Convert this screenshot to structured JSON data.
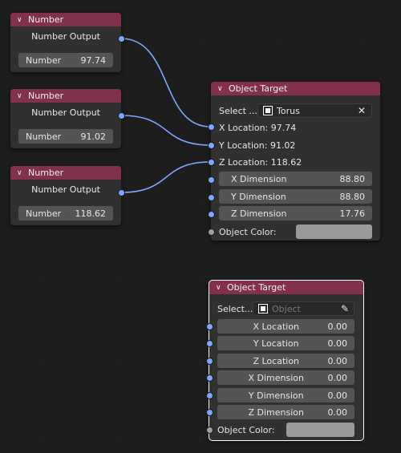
{
  "number_nodes": [
    {
      "title": "Number",
      "output": "Number Output",
      "field_label": "Number",
      "value": "97.74"
    },
    {
      "title": "Number",
      "output": "Number Output",
      "field_label": "Number",
      "value": "91.02"
    },
    {
      "title": "Number",
      "output": "Number Output",
      "field_label": "Number",
      "value": "118.62"
    }
  ],
  "target1": {
    "title": "Object Target",
    "select_label": "Select ...",
    "object_value": "Torus",
    "rows": [
      {
        "label": "X Location: 97.74"
      },
      {
        "label": "Y Location: 91.02"
      },
      {
        "label": "Z Location: 118.62"
      }
    ],
    "dims": [
      {
        "label": "X Dimension",
        "value": "88.80"
      },
      {
        "label": "Y Dimension",
        "value": "88.80"
      },
      {
        "label": "Z Dimension",
        "value": "17.76"
      }
    ],
    "color_label": "Object Color:",
    "color_value": "#9a9a9a"
  },
  "target2": {
    "title": "Object Target",
    "select_label": "Select...",
    "object_placeholder": "Object",
    "fields": [
      {
        "label": "X Location",
        "value": "0.00"
      },
      {
        "label": "Y Location",
        "value": "0.00"
      },
      {
        "label": "Z Location",
        "value": "0.00"
      },
      {
        "label": "X Dimension",
        "value": "0.00"
      },
      {
        "label": "Y Dimension",
        "value": "0.00"
      },
      {
        "label": "Z Dimension",
        "value": "0.00"
      }
    ],
    "color_label": "Object Color:"
  },
  "colors": {
    "header": "#83314a",
    "socket": "#7fa7ff",
    "link": "#7fa7ff",
    "node_bg": "#303030",
    "canvas": "#1d1d1d"
  }
}
